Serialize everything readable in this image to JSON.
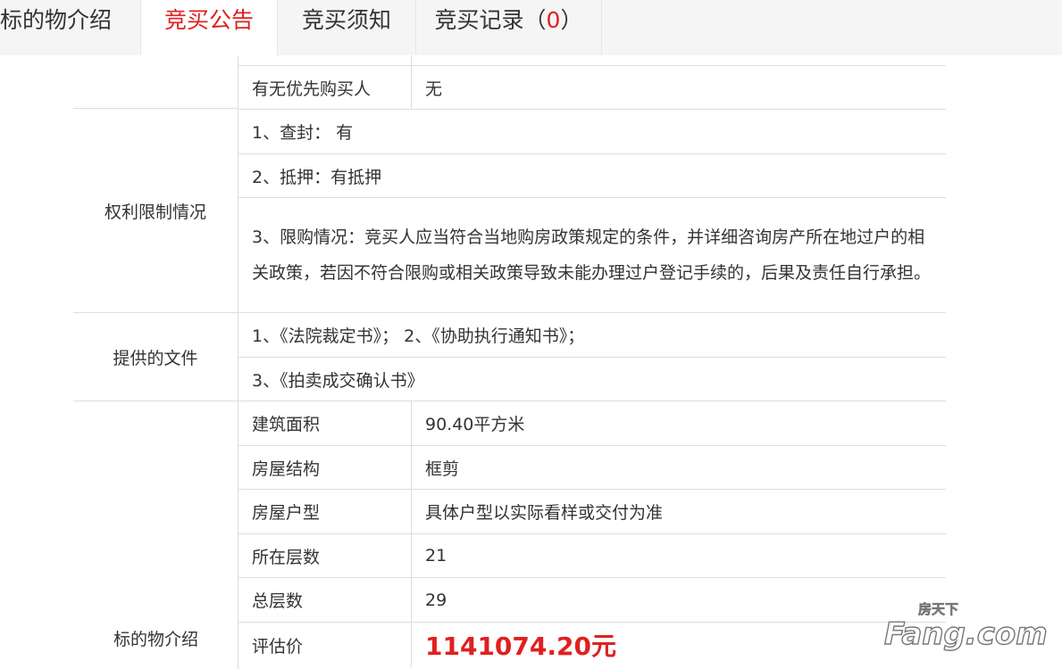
{
  "tabs": [
    {
      "label": "标的物介绍"
    },
    {
      "label": "竞买公告"
    },
    {
      "label": "竞买须知"
    },
    {
      "label": "竞买记录（",
      "count": "0",
      "suffix": "）"
    }
  ],
  "table": {
    "priority_buyer": {
      "label": "有无优先购买人",
      "value": "无"
    },
    "rights": {
      "label": "权利限制情况",
      "items": [
        "1、查封： 有",
        "2、抵押：有抵押",
        "3、限购情况：竞买人应当符合当地购房政策规定的条件，并详细咨询房产所在地过户的相关政策，若因不符合限购或相关政策导致未能办理过户登记手续的，后果及责任自行承担。"
      ]
    },
    "documents": {
      "label": "提供的文件",
      "items": [
        "1、《法院裁定书》； 2、《协助执行通知书》；",
        "3、《拍卖成交确认书》"
      ]
    },
    "object": {
      "label": "标的物介绍",
      "rows": [
        {
          "key": "建筑面积",
          "value": "90.40平方米"
        },
        {
          "key": "房屋结构",
          "value": "框剪"
        },
        {
          "key": "房屋户型",
          "value": "具体户型以实际看样或交付为准"
        },
        {
          "key": "所在层数",
          "value": "21"
        },
        {
          "key": "总层数",
          "value": "29"
        },
        {
          "key": "评估价",
          "value": "1141074.20元"
        }
      ]
    }
  },
  "watermark": {
    "brand_cn": "房天下",
    "brand_en": "Fang.com"
  },
  "colors": {
    "accent": "#e02020",
    "border": "#dddddd",
    "tabbar_bg": "#f5f5f5"
  }
}
